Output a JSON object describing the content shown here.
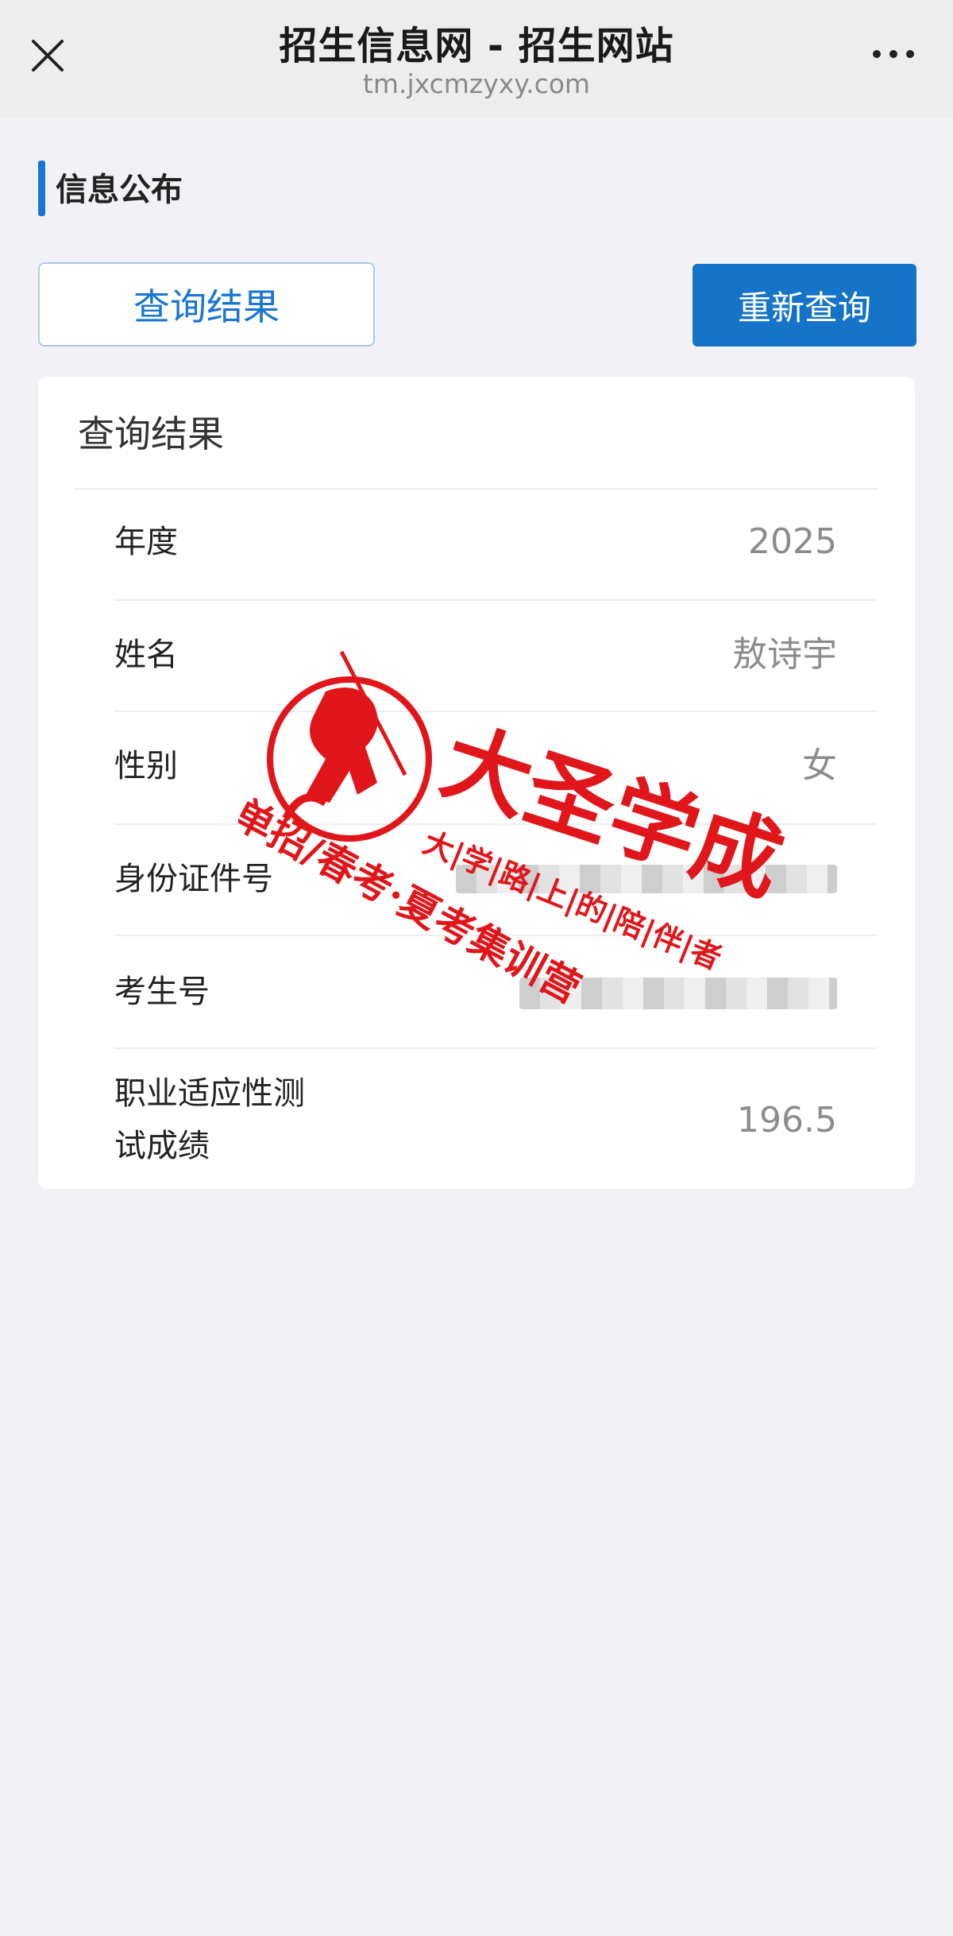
{
  "browser": {
    "title": "招生信息网 - 招生网站",
    "url": "tm.jxcmzyxy.com",
    "close_icon": "close-icon",
    "more_icon": "more-icon"
  },
  "section": {
    "title": "信息公布"
  },
  "buttons": {
    "result_tab": "查询结果",
    "requery": "重新查询",
    "primary_color": "#1674c8"
  },
  "card": {
    "title": "查询结果",
    "rows": [
      {
        "label": "年度",
        "value": "2025"
      },
      {
        "label": "姓名",
        "value": "敖诗宇"
      },
      {
        "label": "性别",
        "value": "女"
      },
      {
        "label": "身份证件号",
        "value": ""
      },
      {
        "label": "考生号",
        "value": ""
      },
      {
        "label_line1": "职业适应性测",
        "label_line2": "试成绩",
        "value": "196.5"
      }
    ]
  },
  "watermark": {
    "brand": "大圣学成",
    "slogan": "大|学|路|上|的|陪|伴|者",
    "subtitle": "单招/春考·夏考集训营",
    "color": "#e0161b"
  }
}
